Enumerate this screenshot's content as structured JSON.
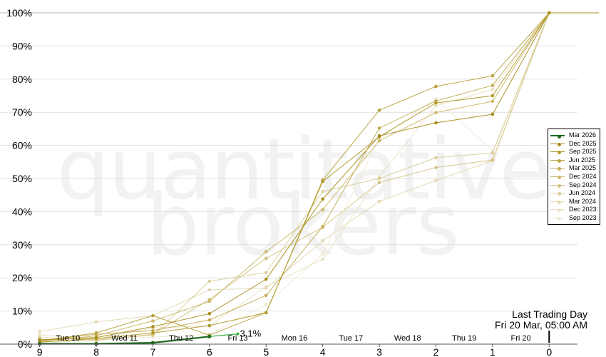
{
  "chart_data": {
    "type": "line",
    "watermark": [
      "quantitative",
      "brokers"
    ],
    "x_ticks": [
      "9",
      "8",
      "7",
      "6",
      "5",
      "4",
      "3",
      "2",
      "1",
      "0"
    ],
    "x_day_labels": [
      "Tue 10",
      "Wed 11",
      "Thu 12",
      "Fri 13",
      "Mon 16",
      "Tue 17",
      "Wed 18",
      "Thu 19",
      "Fri 20"
    ],
    "y_ticks": [
      "0%",
      "10%",
      "20%",
      "30%",
      "40%",
      "50%",
      "60%",
      "70%",
      "80%",
      "90%",
      "100%"
    ],
    "ylim": [
      0,
      100
    ],
    "xlim": [
      9.7,
      -0.5
    ],
    "grid": true,
    "legend_position": "right",
    "current_label": "3.1%",
    "last_trading_day": {
      "title": "Last Trading Day",
      "datetime": "Fri 20 Mar, 05:00 AM"
    },
    "series": [
      {
        "name": "Mar 2026",
        "color": "#1e6b1e",
        "highlight": true,
        "x": [
          9,
          8,
          7,
          6,
          5.5
        ],
        "y": [
          0.1,
          0.1,
          0.4,
          2.3,
          3.1
        ]
      },
      {
        "name": "Dec 2025",
        "color": "#a88e1e",
        "x": [
          9,
          8,
          7,
          6,
          5,
          4,
          3,
          2,
          1,
          0
        ],
        "y": [
          1.3,
          2.0,
          5.3,
          9.2,
          19.6,
          43.8,
          62.9,
          66.8,
          69.4,
          100
        ]
      },
      {
        "name": "Sep 2025",
        "color": "#b09a2a",
        "x": [
          9,
          8,
          7,
          6,
          5,
          4,
          3,
          2,
          1,
          0
        ],
        "y": [
          0.6,
          1.7,
          3.4,
          5.6,
          9.5,
          49.1,
          62.6,
          72.8,
          75.0,
          100
        ]
      },
      {
        "name": "Jun 2025",
        "color": "#b8a23c",
        "x": [
          9,
          8,
          7,
          6,
          5,
          4,
          3,
          2,
          1,
          0
        ],
        "y": [
          0.9,
          3.4,
          8.6,
          2.7,
          9.5,
          49.5,
          70.6,
          77.8,
          81.0,
          100
        ]
      },
      {
        "name": "Mar 2025",
        "color": "#c2ad54",
        "x": [
          9,
          8,
          7,
          6,
          5,
          4,
          3,
          2,
          1,
          0
        ],
        "y": [
          1.0,
          3.0,
          4.1,
          7.3,
          14.7,
          35.5,
          65.2,
          73.4,
          78.1,
          100
        ]
      },
      {
        "name": "Dec 2024",
        "color": "#cbb86a",
        "x": [
          9,
          8,
          7,
          6,
          5,
          4,
          3,
          2,
          1,
          0
        ],
        "y": [
          0.8,
          2.5,
          7.0,
          12.9,
          27.9,
          40.6,
          61.4,
          69.9,
          73.3,
          100
        ]
      },
      {
        "name": "Sep 2024",
        "color": "#d3c382",
        "x": [
          9,
          8,
          7,
          6,
          5,
          4,
          3,
          2,
          1,
          0
        ],
        "y": [
          1.4,
          1.1,
          3.0,
          13.5,
          25.9,
          35.3,
          48.8,
          53.3,
          55.6,
          100
        ]
      },
      {
        "name": "Jun 2024",
        "color": "#dccf9b",
        "x": [
          9,
          8,
          7,
          6,
          5,
          4,
          3,
          2,
          1,
          0
        ],
        "y": [
          2.0,
          1.4,
          2.7,
          19.0,
          21.6,
          46.1,
          50.0,
          56.3,
          57.7,
          100
        ]
      },
      {
        "name": "Mar 2024",
        "color": "#e3d9b1",
        "x": [
          9,
          8,
          7,
          6,
          5,
          4,
          3,
          2,
          1,
          0
        ],
        "y": [
          3.8,
          6.7,
          8.6,
          16.4,
          16.9,
          31.2,
          43.1,
          49.4,
          55.4,
          100
        ]
      },
      {
        "name": "Dec 2023",
        "color": "#e9e1c3",
        "x": [
          9,
          8,
          7,
          6,
          5,
          4,
          3,
          2,
          1,
          0
        ],
        "y": [
          2.8,
          1.6,
          4.9,
          5.5,
          17.4,
          25.6,
          50.5,
          72.0,
          76.9,
          100
        ]
      },
      {
        "name": "Sep 2023",
        "color": "#efe9d3",
        "x": [
          9,
          8,
          7,
          6,
          5,
          4,
          3,
          2,
          1,
          0
        ],
        "y": [
          0.3,
          1.3,
          2.1,
          3.0,
          12.0,
          27.2,
          62.1,
          74.1,
          58.3,
          100
        ]
      }
    ]
  }
}
